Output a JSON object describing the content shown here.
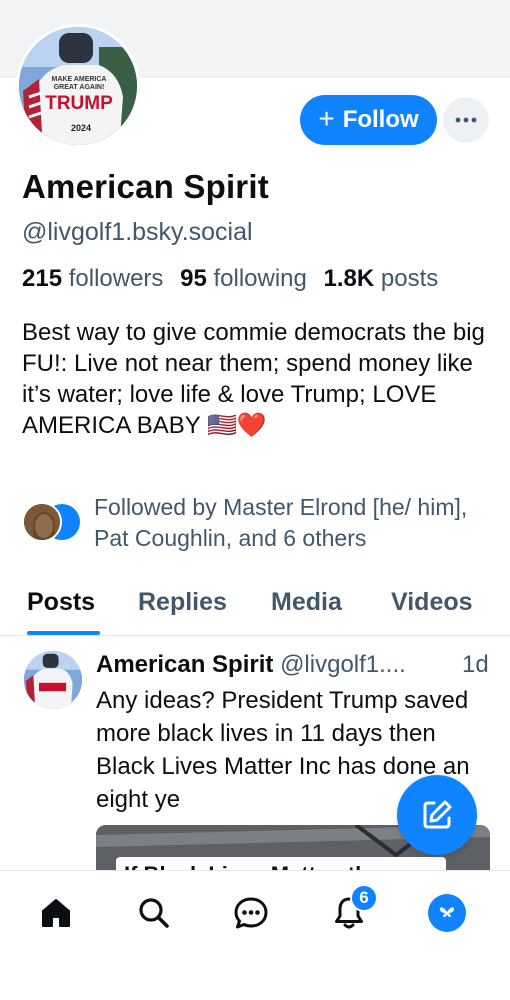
{
  "profile": {
    "display_name": "American Spirit",
    "handle": "@livgolf1.bsky.social",
    "avatar_shirt_text": [
      "MAKE AMERICA",
      "GREAT AGAIN!",
      "TRUMP",
      "2024"
    ],
    "follow_label": "Follow",
    "stats": {
      "followers_count": "215",
      "followers_label": "followers",
      "following_count": "95",
      "following_label": "following",
      "posts_count": "1.8K",
      "posts_label": "posts"
    },
    "bio": "Best way to give commie democrats the big FU!: Live not near them; spend money like it’s water; love life & love Trump; LOVE AMERICA BABY 🇺🇸❤️",
    "followed_by": "Followed by Master Elrond [he/ him], Pat Coughlin, and 6 others"
  },
  "tabs": [
    {
      "label": "Posts",
      "active": true
    },
    {
      "label": "Replies",
      "active": false
    },
    {
      "label": "Media",
      "active": false
    },
    {
      "label": "Videos",
      "active": false
    }
  ],
  "post": {
    "author": "American Spirit",
    "handle": "@livgolf1....",
    "time": "1d",
    "text": "Any ideas? President Trump saved more black lives in 11 days then Black Lives Matter Inc has done an eight ye",
    "media_caption": "If Black Lives Matter, then"
  },
  "nav": {
    "notifications_badge": "6"
  },
  "colors": {
    "accent": "#1083fe",
    "secondary_text": "#42576c",
    "primary_text": "#0b0f14",
    "border": "#e2e6ea"
  },
  "icons": [
    "plus-icon",
    "ellipsis-icon",
    "compose-icon",
    "home-icon",
    "search-icon",
    "chat-icon",
    "bell-icon",
    "butterfly-icon"
  ]
}
